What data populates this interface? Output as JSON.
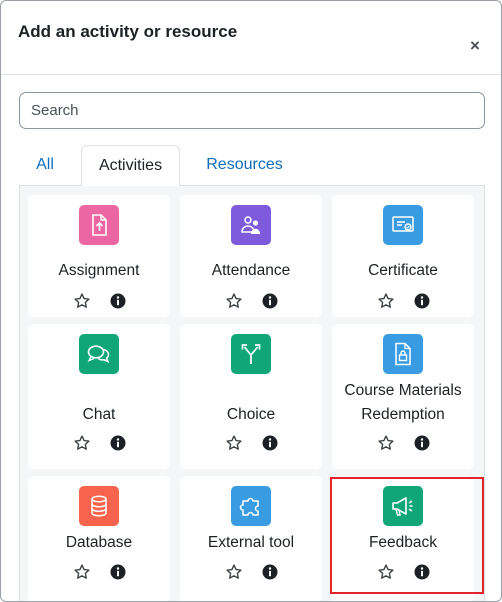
{
  "modal": {
    "title": "Add an activity or resource",
    "close_symbol": "×"
  },
  "search": {
    "placeholder": "Search",
    "value": ""
  },
  "tabs": [
    {
      "label": "All",
      "active": false
    },
    {
      "label": "Activities",
      "active": true
    },
    {
      "label": "Resources",
      "active": false
    }
  ],
  "activities": [
    {
      "name": "Assignment",
      "icon": "assignment-icon",
      "color": "#eb66a2"
    },
    {
      "name": "Attendance",
      "icon": "attendance-icon",
      "color": "#7e5bdc"
    },
    {
      "name": "Certificate",
      "icon": "certificate-icon",
      "color": "#399be2"
    },
    {
      "name": "Chat",
      "icon": "chat-icon",
      "color": "#11a676"
    },
    {
      "name": "Choice",
      "icon": "choice-icon",
      "color": "#11a676"
    },
    {
      "name": "Course Materials Redemption",
      "icon": "course-materials-icon",
      "color": "#399be2"
    },
    {
      "name": "Database",
      "icon": "database-icon",
      "color": "#f7634d"
    },
    {
      "name": "External tool",
      "icon": "external-tool-icon",
      "color": "#399be2"
    },
    {
      "name": "Feedback",
      "icon": "feedback-icon",
      "color": "#11a676"
    }
  ],
  "highlight_color": "#e3242b"
}
